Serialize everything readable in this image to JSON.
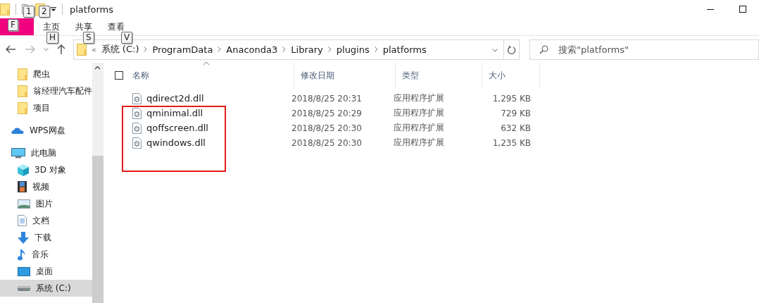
{
  "window": {
    "title": "platforms"
  },
  "quick_access_toolbar": [
    {
      "kind": "properties",
      "keytip": "1"
    },
    {
      "kind": "folder",
      "keytip": "2"
    }
  ],
  "file_tab": {
    "keytip": "F"
  },
  "ribbon_tabs": [
    {
      "label": "主页",
      "keytip": "H",
      "selected": false
    },
    {
      "label": "共享",
      "keytip": "S",
      "selected": false
    },
    {
      "label": "查看",
      "keytip": "V",
      "selected": false
    }
  ],
  "address": {
    "overflow": "«",
    "crumbs": [
      "系统 (C:)",
      "ProgramData",
      "Anaconda3",
      "Library",
      "plugins",
      "platforms"
    ]
  },
  "search": {
    "placeholder": "搜索\"platforms\""
  },
  "sidebar": {
    "pinned": [
      {
        "label": "爬虫",
        "kind": "folder",
        "selected": false
      },
      {
        "label": "翁经理汽车配件",
        "kind": "folder",
        "selected": false
      },
      {
        "label": "项目",
        "kind": "folder",
        "selected": false
      }
    ],
    "items": [
      {
        "label": "WPS网盘",
        "kind": "cloud",
        "selected": false
      },
      {
        "label": "此电脑",
        "kind": "pc",
        "selected": false,
        "children": [
          {
            "label": "3D 对象",
            "kind": "cube",
            "selected": false
          },
          {
            "label": "视频",
            "kind": "video",
            "selected": false
          },
          {
            "label": "图片",
            "kind": "picture",
            "selected": false
          },
          {
            "label": "文档",
            "kind": "document",
            "selected": false
          },
          {
            "label": "下载",
            "kind": "download",
            "selected": false
          },
          {
            "label": "音乐",
            "kind": "music",
            "selected": false
          },
          {
            "label": "桌面",
            "kind": "desktop",
            "selected": false
          },
          {
            "label": "系统 (C:)",
            "kind": "drive",
            "selected": true
          }
        ]
      }
    ]
  },
  "table": {
    "select_all": {
      "checked": false
    },
    "columns": [
      "名称",
      "修改日期",
      "类型",
      "大小"
    ],
    "rows": [
      {
        "name": "qdirect2d.dll",
        "modified": "2018/8/25 20:31",
        "type": "应用程序扩展",
        "size": "1,295 KB",
        "highlighted": false
      },
      {
        "name": "qminimal.dll",
        "modified": "2018/8/25 20:29",
        "type": "应用程序扩展",
        "size": "729 KB",
        "highlighted": true
      },
      {
        "name": "qoffscreen.dll",
        "modified": "2018/8/25 20:30",
        "type": "应用程序扩展",
        "size": "632 KB",
        "highlighted": true
      },
      {
        "name": "qwindows.dll",
        "modified": "2018/8/25 20:30",
        "type": "应用程序扩展",
        "size": "1,235 KB",
        "highlighted": true
      }
    ]
  }
}
